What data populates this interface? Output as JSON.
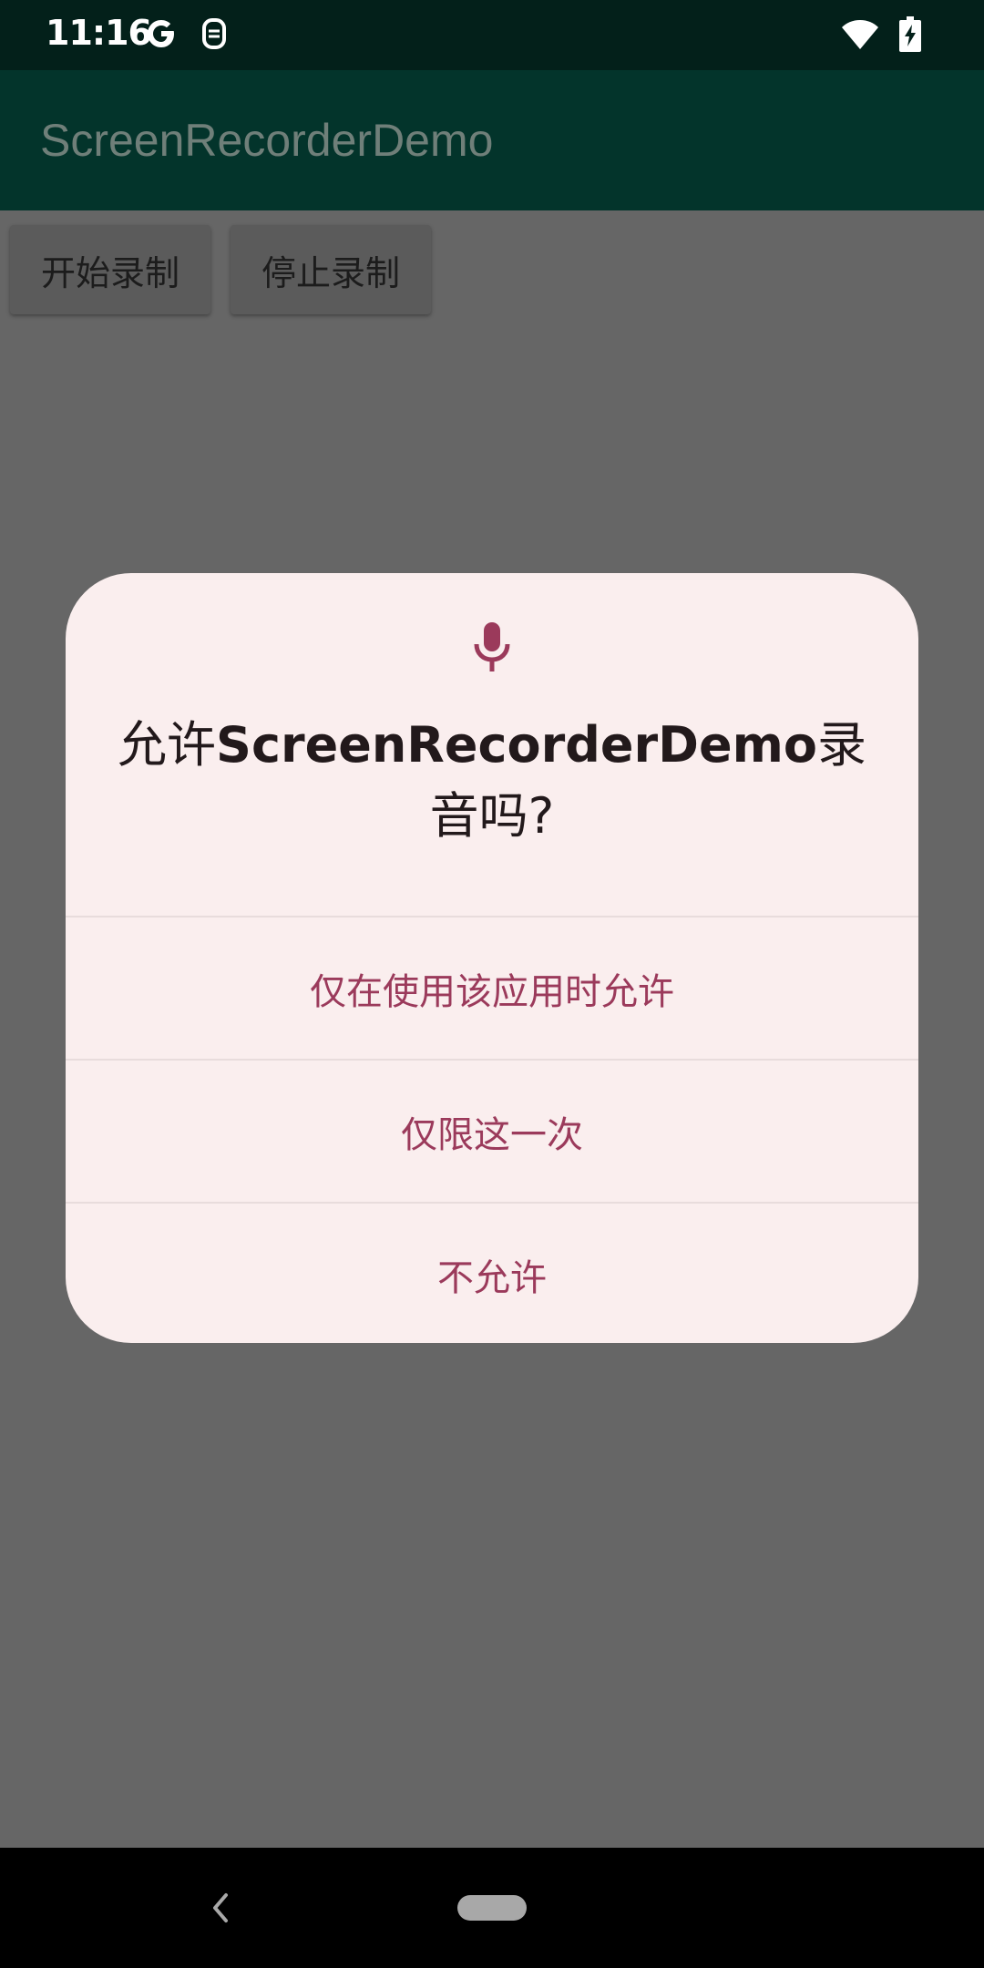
{
  "status_bar": {
    "time": "11:16",
    "icons": [
      "google-icon",
      "sim-icon",
      "wifi-icon",
      "battery-charging-icon"
    ]
  },
  "app": {
    "title": "ScreenRecorderDemo",
    "buttons": {
      "start": "开始录制",
      "stop": "停止录制"
    }
  },
  "dialog": {
    "icon": "microphone-icon",
    "title_prefix": "允许",
    "title_app": "ScreenRecorderDemo",
    "title_suffix": "录音吗?",
    "options": [
      "仅在使用该应用时允许",
      "仅限这一次",
      "不允许"
    ]
  },
  "colors": {
    "status_bar": "#03201a",
    "app_bar": "#03342b",
    "scrim_background": "#666666",
    "dialog_background": "#faeeee",
    "accent": "#9b3a5b"
  },
  "nav_bar": {
    "icons": [
      "back-icon",
      "home-pill-icon"
    ]
  }
}
